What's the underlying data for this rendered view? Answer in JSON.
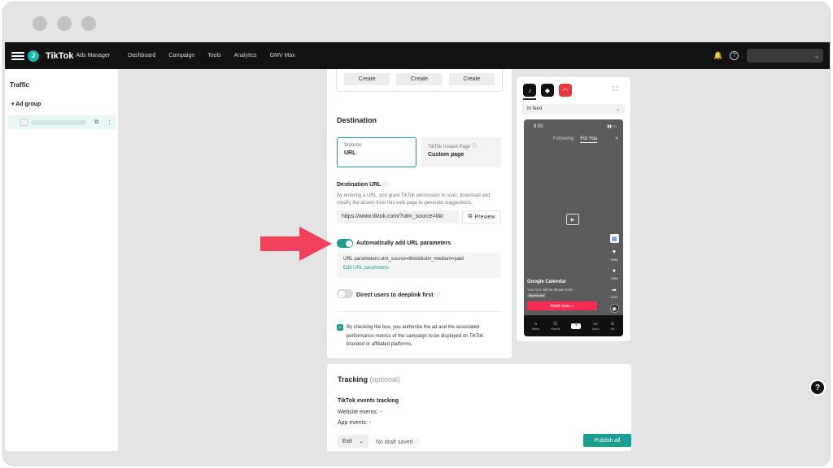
{
  "topbar": {
    "avatar_letter": "J",
    "logo": "TikTok",
    "logo_sub": "Ads Manager",
    "nav": [
      "Dashboard",
      "Campaign",
      "Tools",
      "Analytics",
      "GMV Max"
    ]
  },
  "sidebar": {
    "title": "Traffic",
    "group_label": "Ad group"
  },
  "create_buttons": [
    "Create",
    "Create",
    "Create"
  ],
  "destination": {
    "title": "Destination",
    "options": [
      {
        "label": "Website",
        "value": "URL"
      },
      {
        "label": "TikTok Instant Page",
        "value": "Custom page"
      }
    ],
    "url_label": "Destination URL",
    "url_help": "By entering a URL, you grant TikTok permission to scan, download and modify the assets from this web page to generate suggestions.",
    "url_value": "https://www.tiktok.com/?utm_source=tikt",
    "preview_label": "Preview",
    "auto_params_label": "Automatically add URL parameters",
    "params_text": "URL parameters:utm_source=tiktok&utm_medium=paid",
    "edit_params_label": "Edit URL parameters",
    "deeplink_label": "Direct users to deeplink first",
    "consent_text": "By checking the box, you authorize the ad and the associated performance metrics of the campaign to be displayed on TikTok branded or affiliated platforms."
  },
  "preview": {
    "placement": "In feed",
    "time": "8:00",
    "tabs": [
      "Following",
      "For You"
    ],
    "side_counts": [
      "9998",
      "3456",
      "1234"
    ],
    "brand": "Google Calendar",
    "caption": "Your text will be shown here",
    "sponsored": "Sponsored",
    "cta": "Read more >",
    "bottom_nav": [
      "Home",
      "Friends",
      "",
      "Inbox",
      "Me"
    ]
  },
  "tracking": {
    "title": "Tracking",
    "optional": "(optional)",
    "events_title": "TikTok events tracking",
    "website_events": "Website events: -",
    "app_events": "App events: -"
  },
  "footer": {
    "exit_label": "Exit",
    "draft_status": "No draft saved",
    "publish_label": "Publish all"
  },
  "colors": {
    "accent": "#1a9e92",
    "arrow": "#f0405a",
    "topbar": "#121212"
  }
}
